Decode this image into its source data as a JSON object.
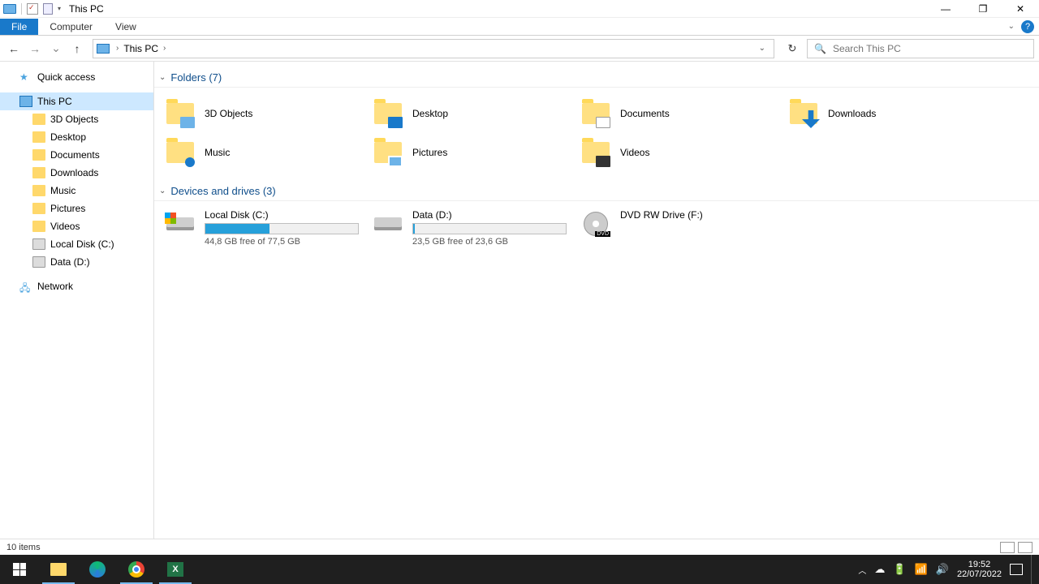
{
  "window": {
    "title": "This PC"
  },
  "ribbon": {
    "file": "File",
    "tabs": [
      "Computer",
      "View"
    ]
  },
  "nav": {
    "breadcrumb": "This PC",
    "search_placeholder": "Search This PC"
  },
  "sidebar": {
    "quick_access": "Quick access",
    "this_pc": "This PC",
    "children": [
      "3D Objects",
      "Desktop",
      "Documents",
      "Downloads",
      "Music",
      "Pictures",
      "Videos",
      "Local Disk (C:)",
      "Data (D:)"
    ],
    "network": "Network"
  },
  "groups": {
    "folders": {
      "header": "Folders (7)",
      "items": [
        "3D Objects",
        "Desktop",
        "Documents",
        "Downloads",
        "Music",
        "Pictures",
        "Videos"
      ]
    },
    "drives": {
      "header": "Devices and drives (3)",
      "items": [
        {
          "name": "Local Disk (C:)",
          "free": "44,8 GB free of 77,5 GB",
          "fill_pct": 42,
          "kind": "winhdd"
        },
        {
          "name": "Data (D:)",
          "free": "23,5 GB free of 23,6 GB",
          "fill_pct": 1,
          "kind": "hdd"
        },
        {
          "name": "DVD RW Drive (F:)",
          "free": "",
          "fill_pct": null,
          "kind": "dvd"
        }
      ]
    }
  },
  "status": {
    "text": "10 items"
  },
  "tray": {
    "time": "19:52",
    "date": "22/07/2022"
  }
}
